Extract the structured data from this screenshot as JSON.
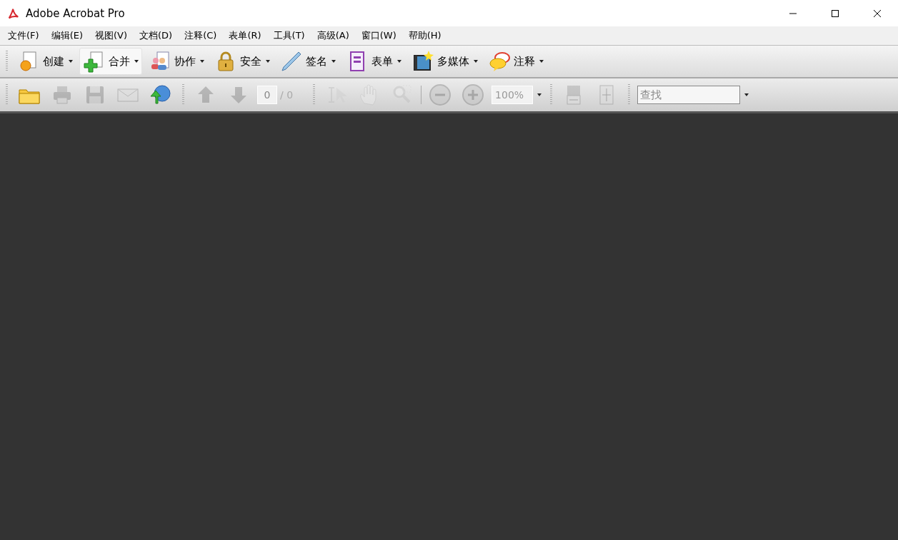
{
  "window": {
    "title": "Adobe Acrobat Pro"
  },
  "menu": [
    {
      "label": "文件(F)"
    },
    {
      "label": "编辑(E)"
    },
    {
      "label": "视图(V)"
    },
    {
      "label": "文档(D)"
    },
    {
      "label": "注释(C)"
    },
    {
      "label": "表单(R)"
    },
    {
      "label": "工具(T)"
    },
    {
      "label": "高级(A)"
    },
    {
      "label": "窗口(W)"
    },
    {
      "label": "帮助(H)"
    }
  ],
  "tasks": [
    {
      "label": "创建",
      "highlighted": false
    },
    {
      "label": "合并",
      "highlighted": true
    },
    {
      "label": "协作",
      "highlighted": false
    },
    {
      "label": "安全",
      "highlighted": false
    },
    {
      "label": "签名",
      "highlighted": false
    },
    {
      "label": "表单",
      "highlighted": false
    },
    {
      "label": "多媒体",
      "highlighted": false
    },
    {
      "label": "注释",
      "highlighted": false
    }
  ],
  "toolbar": [
    {
      "kind": "grip"
    },
    {
      "kind": "button",
      "disabled": false
    },
    {
      "kind": "button",
      "disabled": true
    },
    {
      "kind": "button",
      "disabled": true
    },
    {
      "kind": "button",
      "disabled": true
    },
    {
      "kind": "button",
      "disabled": false
    },
    {
      "kind": "grip"
    },
    {
      "kind": "button",
      "disabled": true
    },
    {
      "kind": "button",
      "disabled": true
    },
    {
      "kind": "page",
      "value": "0",
      "count": "/ 0"
    },
    {
      "kind": "grip"
    },
    {
      "kind": "button",
      "disabled": true
    },
    {
      "kind": "button",
      "disabled": true
    },
    {
      "kind": "button",
      "disabled": true
    },
    {
      "kind": "separator"
    },
    {
      "kind": "button",
      "disabled": true
    },
    {
      "kind": "button",
      "disabled": true
    },
    {
      "kind": "zoom",
      "value": "100%"
    },
    {
      "kind": "grip"
    },
    {
      "kind": "button",
      "disabled": true
    },
    {
      "kind": "button",
      "disabled": true
    },
    {
      "kind": "grip"
    },
    {
      "kind": "search",
      "placeholder": "查找"
    }
  ]
}
